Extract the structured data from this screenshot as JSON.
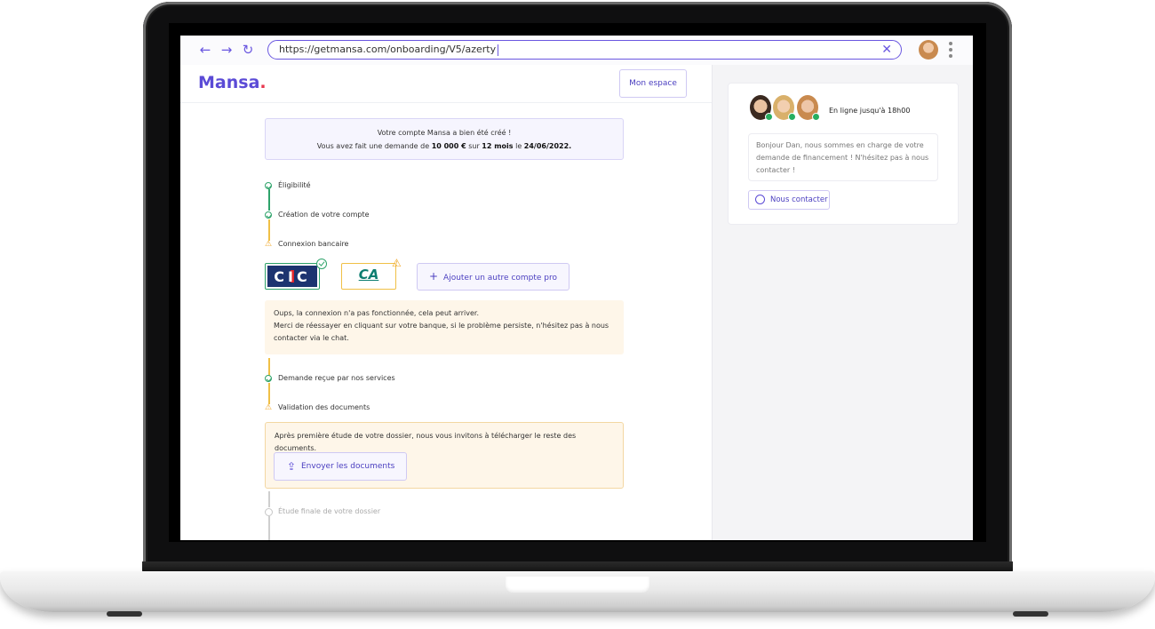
{
  "browser": {
    "url": "https://getmansa.com/onboarding/V5/azerty",
    "back_icon": "arrow-left-icon",
    "forward_icon": "arrow-right-icon",
    "reload_icon": "reload-icon",
    "clear_icon": "close-icon",
    "back_glyph": "←",
    "forward_glyph": "→",
    "reload_glyph": "↻",
    "clear_glyph": "✕"
  },
  "header": {
    "logo": "Mansa",
    "logo_dot": ".",
    "space_button": "Mon espace"
  },
  "notice": {
    "line1": "Votre compte Mansa a bien été créé !",
    "line2_prefix": "Vous avez fait une demande de ",
    "amount": "10 000 €",
    "line2_mid": " sur ",
    "duration": "12 mois",
    "line2_mid2": " le ",
    "date": "24/06/2022."
  },
  "steps": {
    "eligibility": "Éligibilité",
    "account_creation": "Création de votre compte",
    "bank_connection": "Connexion bancaire",
    "request_received": "Demande reçue par nos services",
    "documents_validation": "Validation des documents",
    "final_study": "Étude finale de votre dossier"
  },
  "banks": {
    "cic_label": "CIC",
    "ca_label": "CA",
    "add_button": "Ajouter un autre compte pro",
    "add_glyph": "+"
  },
  "bank_alert": {
    "line1": "Oups, la connexion n'a pas fonctionnée, cela peut arriver.",
    "line2": "Merci de réessayer en cliquant sur votre banque, si le problème persiste, n'hésitez pas à nous contacter via le chat."
  },
  "docs_alert": {
    "text": "Après première étude de votre dossier, nous vous invitons à télécharger le reste des documents.",
    "button": "Envoyer les documents"
  },
  "chat": {
    "status": "En ligne jusqu'à 18h00",
    "message": "Bonjour Dan, nous sommes en charge de votre demande de financement ! N'hésitez pas à nous contacter !",
    "contact_button": "Nous contacter"
  },
  "colors": {
    "brand": "#5b4bd6",
    "logo_dot": "#e8384f",
    "success": "#2ea36a",
    "warning": "#f0a524"
  }
}
